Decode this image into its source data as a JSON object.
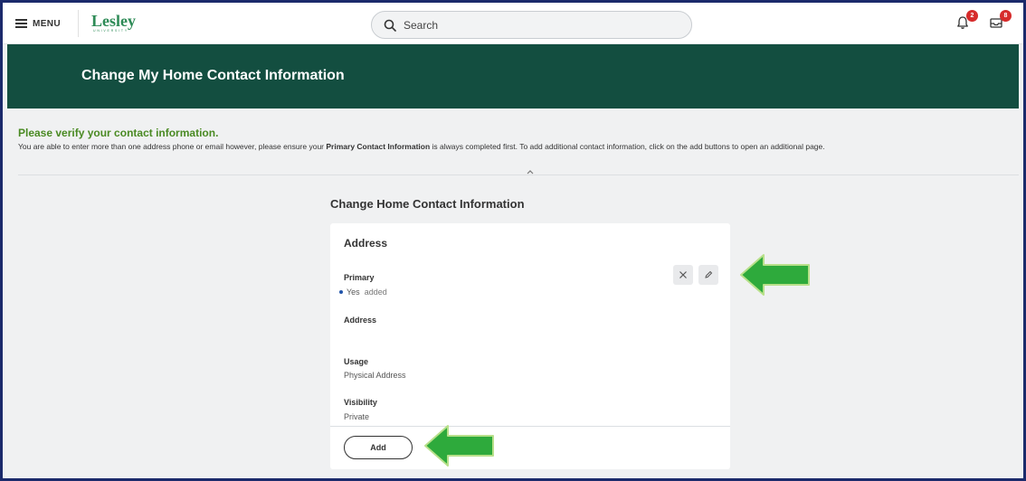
{
  "topnav": {
    "menu_label": "MENU",
    "logo_text": "Lesley",
    "logo_subtext": "UNIVERSITY",
    "search_placeholder": "Search",
    "notifications_count": "2",
    "inbox_count": "8"
  },
  "banner": {
    "title": "Change My Home Contact Information"
  },
  "verify": {
    "title": "Please verify your contact information.",
    "text_before": "You are able to enter more than one address phone or email however, please ensure your ",
    "text_bold": "Primary Contact Information",
    "text_after": " is always completed first. To add additional contact information, click on the add buttons to open an additional page."
  },
  "section": {
    "title": "Change Home Contact Information"
  },
  "card": {
    "title": "Address",
    "primary_label": "Primary",
    "primary_value": "Yes",
    "primary_status": "added",
    "address_label": "Address",
    "address_value": "",
    "usage_label": "Usage",
    "usage_value": "Physical Address",
    "visibility_label": "Visibility",
    "visibility_value": "Private",
    "add_label": "Add"
  },
  "colors": {
    "banner_bg": "#134e40",
    "accent_green": "#4a8a23",
    "logo_green": "#2e8b57",
    "badge_red": "#d62b2b",
    "arrow_green": "#2eaa3c",
    "frame_border": "#1b2a6b"
  },
  "icons": {
    "menu": "hamburger-icon",
    "search": "search-icon",
    "notifications": "bell-icon",
    "inbox": "inbox-icon",
    "remove": "close-icon",
    "edit": "pencil-icon",
    "collapse": "chevron-up-icon",
    "annotation": "arrow-left-icon"
  }
}
